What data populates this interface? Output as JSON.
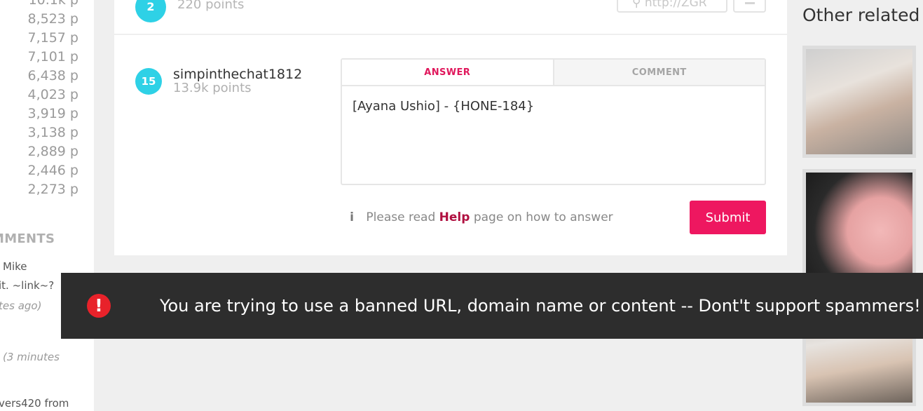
{
  "left_column": {
    "scores": [
      "10.1k p",
      "8,523 p",
      "7,157 p",
      "7,101 p",
      "6,438 p",
      "4,023 p",
      "3,919 p",
      "3,138 p",
      "2,889 p",
      "2,446 p",
      "2,273 p"
    ],
    "comments_heading": "MMENTS",
    "recent_comments": [
      "Mike",
      "it. ~link~?",
      "tes ago)",
      "(3 minutes",
      "vers420 from"
    ]
  },
  "top_card": {
    "avatar_label": "2",
    "points": "220 points",
    "link_text": "http://ZGR"
  },
  "answer_card": {
    "avatar_label": "15",
    "username": "simpinthechat1812",
    "points": "13.9k points",
    "tabs": [
      "ANSWER",
      "COMMENT"
    ],
    "answer_text": "[Ayana Ushio] - {HONE-184}",
    "help": {
      "before": "Please read",
      "link": "Help",
      "after": "page on how to answer"
    },
    "submit_label": "Submit"
  },
  "right_column": {
    "title": "Other related"
  },
  "toast": {
    "message": "You are trying to use a banned URL, domain name or content -- Dont't support spammers!",
    "icon": "!"
  },
  "colors": {
    "accent": "#ee1760",
    "tab_active": "#e0185c",
    "avatar": "#2ed1e6",
    "toast_bg": "#2d2d2d",
    "error": "#e8222a"
  }
}
